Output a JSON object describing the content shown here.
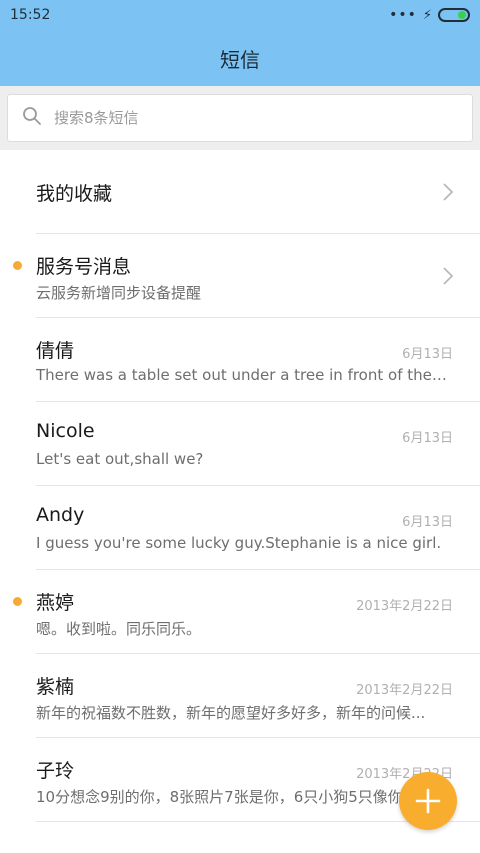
{
  "status_bar": {
    "time": "15:52",
    "signal_icon": "dots-icon",
    "charging_icon": "bolt-icon",
    "battery_icon": "battery-icon",
    "battery_color": "#3ad14a"
  },
  "header": {
    "title": "短信",
    "background": "#7cc2f2"
  },
  "search": {
    "placeholder": "搜索8条短信",
    "icon": "search-icon"
  },
  "rows": [
    {
      "name": "我的收藏",
      "preview": "",
      "date": "",
      "chevron": true,
      "unread": false
    },
    {
      "name": "服务号消息",
      "preview": "云服务新增同步设备提醒",
      "date": "",
      "chevron": true,
      "unread": true
    },
    {
      "name": "倩倩",
      "preview": "There was a table set out under a tree in front of the ho...",
      "date": "6月13日",
      "chevron": false,
      "unread": false
    },
    {
      "name": "Nicole",
      "preview": "Let's eat out,shall we?",
      "date": "6月13日",
      "chevron": false,
      "unread": false
    },
    {
      "name": "Andy",
      "preview": "I guess you're some lucky guy.Stephanie is a nice girl.",
      "date": "6月13日",
      "chevron": false,
      "unread": false
    },
    {
      "name": "燕婷",
      "preview": "嗯。收到啦。同乐同乐。",
      "date": "2013年2月22日",
      "chevron": false,
      "unread": true
    },
    {
      "name": "紫楠",
      "preview": "新年的祝福数不胜数，新年的愿望好多好多，新年的问候...",
      "date": "2013年2月22日",
      "chevron": false,
      "unread": false
    },
    {
      "name": "子玲",
      "preview": "10分想念9别的你，8张照片7张是你，6只小狗5只像你",
      "date": "2013年2月22日",
      "chevron": false,
      "unread": false
    }
  ],
  "fab": {
    "icon": "plus-icon",
    "color": "#f9ad2e"
  },
  "colors": {
    "unread_dot": "#f7a935"
  }
}
